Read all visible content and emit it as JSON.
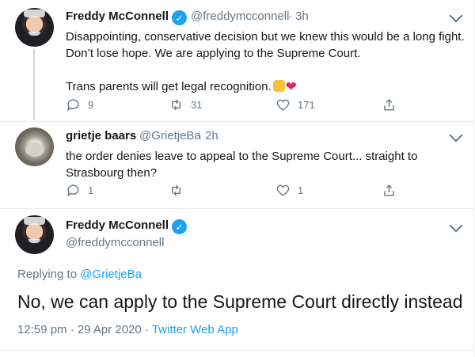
{
  "tweets": [
    {
      "name": "Freddy McConnell",
      "handle": "@freddymcconnell",
      "time": "3h",
      "text_line1": "Disappointing, conservative decision but we knew this would be a long fight.",
      "text_line2": "Don’t lose hope. We are applying to the Supreme Court.",
      "text_line3": "Trans parents will get legal recognition.",
      "emoji": [
        "raised-fist-emoji",
        "red-heart-emoji"
      ],
      "replies": "9",
      "retweets": "31",
      "likes": "171"
    },
    {
      "name": "grietje baars",
      "handle": "@GrietjeBa",
      "time": "2h",
      "text_line1": "the order denies leave to appeal to the Supreme Court... straight to",
      "text_line2": "Strasbourg then?",
      "replies": "1",
      "retweets": "",
      "likes": "1"
    }
  ],
  "main_tweet": {
    "name": "Freddy McConnell",
    "handle": "@freddymcconnell",
    "replying_to_label": "Replying to",
    "replying_to_handle": "@GrietjeBa",
    "text": "No, we can apply to the Supreme Court directly instead",
    "timestamp": "12:59 pm · 29 Apr 2020 ·",
    "client": "Twitter Web App"
  },
  "separator": "·",
  "colors": {
    "accent": "#1da1f2",
    "secondary_text": "#657786",
    "primary_text": "#14171a",
    "heart": "#e0245e"
  }
}
